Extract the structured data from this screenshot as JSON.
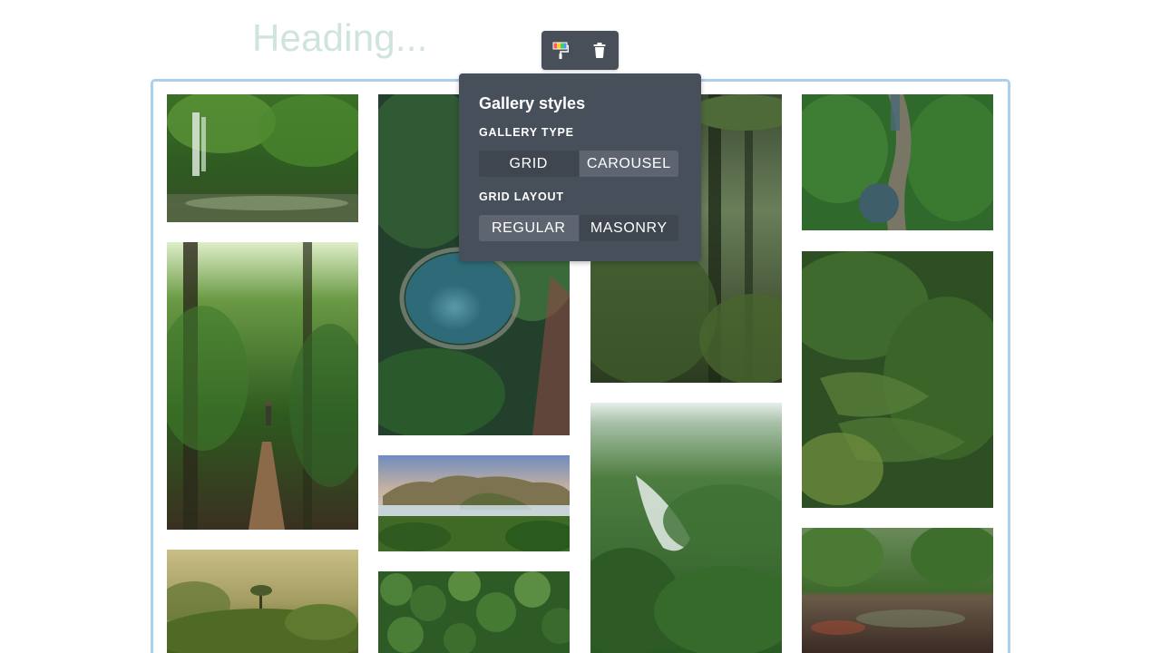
{
  "heading": {
    "placeholder": "Heading..."
  },
  "toolbar": {
    "style_icon": "paint-roller-icon",
    "delete_icon": "trash-icon"
  },
  "gallery": {
    "images": [
      {
        "id": "waterfall",
        "palette": [
          "#1f3d1c",
          "#3f7a2c",
          "#8ec26b"
        ]
      },
      {
        "id": "forest-path",
        "palette": [
          "#2b4a1e",
          "#5a8a3a",
          "#cfe6b0"
        ]
      },
      {
        "id": "misty-canopy",
        "palette": [
          "#6b6a3a",
          "#a8a268",
          "#3d4f1f"
        ]
      },
      {
        "id": "aerial-lagoon",
        "palette": [
          "#203a30",
          "#3d7a86",
          "#2f5a3a"
        ]
      },
      {
        "id": "limestone-valley",
        "palette": [
          "#7d93b8",
          "#9a8a5c",
          "#3e6b2d"
        ]
      },
      {
        "id": "treetop-aerial",
        "palette": [
          "#264a22",
          "#4d7d38",
          "#7faa5a"
        ]
      },
      {
        "id": "mossy-woods",
        "palette": [
          "#1e2e1a",
          "#4e6a3a",
          "#a4c08c"
        ]
      },
      {
        "id": "foggy-hills",
        "palette": [
          "#2f5a30",
          "#6a9a5a",
          "#dfe8e4"
        ]
      },
      {
        "id": "river-gorge",
        "palette": [
          "#234a22",
          "#3f7a35",
          "#2c4a5a"
        ]
      },
      {
        "id": "rice-terraces",
        "palette": [
          "#1e3a1a",
          "#3f6a2c",
          "#8aaa5a"
        ]
      },
      {
        "id": "jungle-river",
        "palette": [
          "#3a5a2c",
          "#6a8a4c",
          "#6a3a2a"
        ]
      }
    ]
  },
  "popover": {
    "title": "Gallery styles",
    "gallery_type_label": "GALLERY TYPE",
    "gallery_type_options": [
      "GRID",
      "CAROUSEL"
    ],
    "gallery_type_selected": "CAROUSEL",
    "grid_layout_label": "GRID LAYOUT",
    "grid_layout_options": [
      "REGULAR",
      "MASONRY"
    ],
    "grid_layout_selected": "REGULAR"
  },
  "colors": {
    "frame_border": "#a8d1f0",
    "popover_bg": "#474f5a",
    "heading_placeholder": "#cfe3df"
  }
}
